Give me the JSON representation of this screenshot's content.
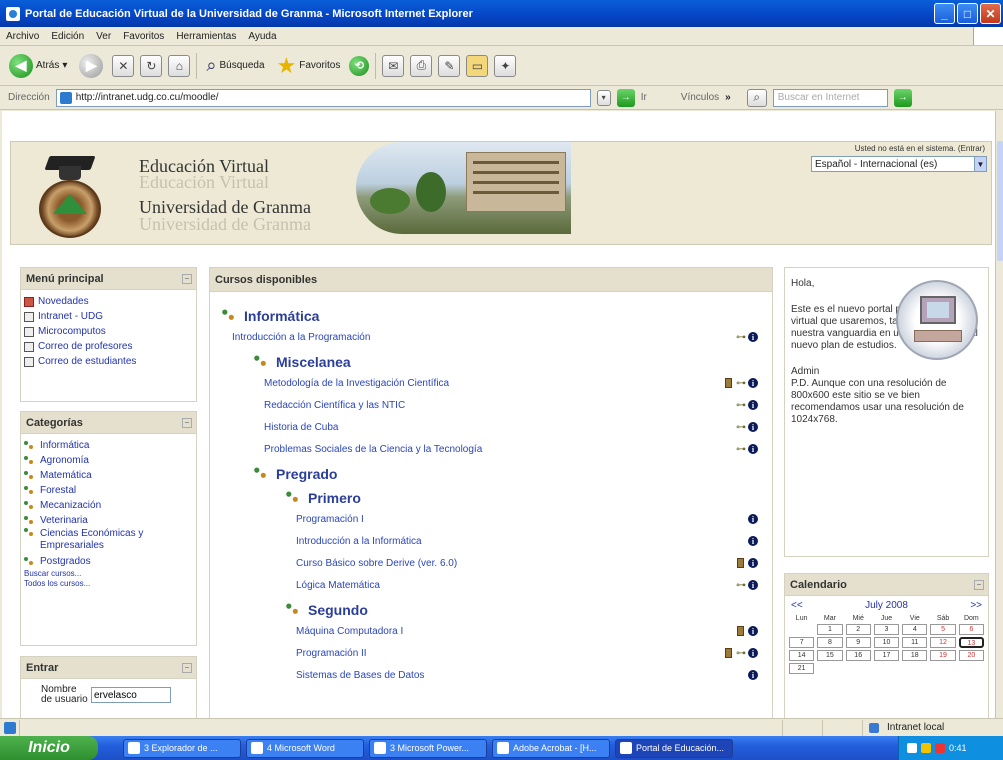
{
  "window": {
    "title": "Portal de Educación Virtual de la Universidad de Granma - Microsoft Internet Explorer",
    "min": "_",
    "max": "□",
    "close": "✕"
  },
  "menu": [
    "Archivo",
    "Edición",
    "Ver",
    "Favoritos",
    "Herramientas",
    "Ayuda"
  ],
  "toolbar": {
    "back_label": "Atrás",
    "search_label": "Búsqueda",
    "favorites_label": "Favoritos"
  },
  "addressbar": {
    "label": "Dirección",
    "url": "http://intranet.udg.co.cu/moodle/",
    "go_label": "Ir",
    "links_label": "Vínculos",
    "search_placeholder": "Buscar en Internet"
  },
  "header": {
    "title_line1": "Educación Virtual",
    "title_line2": "Universidad de Granma",
    "login_info": "Usted no está en el sistema. (Entrar)",
    "language": "Español - Internacional (es)"
  },
  "main_menu": {
    "title": "Menú principal",
    "items": [
      {
        "label": "Novedades",
        "icon": "news-icon"
      },
      {
        "label": "Intranet - UDG",
        "icon": "page-icon"
      },
      {
        "label": "Microcomputos",
        "icon": "page-icon"
      },
      {
        "label": "Correo de profesores",
        "icon": "page-icon"
      },
      {
        "label": "Correo de estudiantes",
        "icon": "page-icon"
      }
    ]
  },
  "categories": {
    "title": "Categorías",
    "items": [
      "Informática",
      "Agronomía",
      "Matemática",
      "Forestal",
      "Mecanización",
      "Veterinaria",
      "Ciencias Económicas y Empresariales",
      "Postgrados"
    ],
    "search_link": "Buscar cursos...",
    "all_link": "Todos los cursos..."
  },
  "login": {
    "title": "Entrar",
    "username_label": "Nombre de usuario",
    "username_value": "ervelasco"
  },
  "courses": {
    "title": "Cursos disponibles",
    "sections": [
      {
        "kind": "cat",
        "level": 0,
        "label": "Informática"
      },
      {
        "kind": "course",
        "level": 0,
        "label": "Introducción a la Programación",
        "icons": [
          "key",
          "info"
        ]
      },
      {
        "kind": "cat",
        "level": 1,
        "label": "Miscelanea"
      },
      {
        "kind": "course",
        "level": 1,
        "label": "Metodología de la Investigación Científica",
        "icons": [
          "teacher",
          "key",
          "info"
        ]
      },
      {
        "kind": "course",
        "level": 1,
        "label": "Redacción Científica y las NTIC",
        "icons": [
          "key",
          "info"
        ]
      },
      {
        "kind": "course",
        "level": 1,
        "label": "Historia de Cuba",
        "icons": [
          "key",
          "info"
        ]
      },
      {
        "kind": "course",
        "level": 1,
        "label": "Problemas Sociales de la Ciencia y la Tecnología",
        "icons": [
          "key",
          "info"
        ]
      },
      {
        "kind": "cat",
        "level": 1,
        "label": "Pregrado"
      },
      {
        "kind": "cat",
        "level": 2,
        "label": "Primero"
      },
      {
        "kind": "course",
        "level": 2,
        "label": "Programación I",
        "icons": [
          "info"
        ]
      },
      {
        "kind": "course",
        "level": 2,
        "label": "Introducción a la Informática",
        "icons": [
          "info"
        ]
      },
      {
        "kind": "course",
        "level": 2,
        "label": "Curso Básico sobre Derive (ver. 6.0)",
        "icons": [
          "teacher",
          "info"
        ]
      },
      {
        "kind": "course",
        "level": 2,
        "label": "Lógica Matemática",
        "icons": [
          "key",
          "info"
        ]
      },
      {
        "kind": "cat",
        "level": 2,
        "label": "Segundo"
      },
      {
        "kind": "course",
        "level": 2,
        "label": "Máquina Computadora I",
        "icons": [
          "teacher",
          "info"
        ]
      },
      {
        "kind": "course",
        "level": 2,
        "label": "Programación II",
        "icons": [
          "teacher",
          "key",
          "info"
        ]
      },
      {
        "kind": "course",
        "level": 2,
        "label": "Sistemas de Bases de Datos",
        "icons": [
          "info"
        ]
      }
    ]
  },
  "welcome": {
    "greeting": "Hola,",
    "body1": "Este es el nuevo portal para la educación virtual que usaremos, también será nuestra vanguardia en un acercamiento al nuevo plan de estudios.",
    "signature": "Admin",
    "body2": "P.D. Aunque con una resolución de 800x600 este sitio se ve bien recomendamos usar una resolución de 1024x768."
  },
  "calendar": {
    "title": "Calendario",
    "prev": "<<",
    "next": ">>",
    "month": "July 2008",
    "days": [
      "Lun",
      "Mar",
      "Mié",
      "Jue",
      "Vie",
      "Sáb",
      "Dom"
    ],
    "today": 13
  },
  "status": {
    "zone": "Intranet local"
  },
  "taskbar": {
    "start": "Inicio",
    "tasks": [
      {
        "label": "3 Explorador de ...",
        "active": false
      },
      {
        "label": "4 Microsoft Word",
        "active": false
      },
      {
        "label": "3 Microsoft Power...",
        "active": false
      },
      {
        "label": "Adobe Acrobat - [H...",
        "active": false
      },
      {
        "label": "Portal de Educación...",
        "active": true
      }
    ],
    "clock": "0:41"
  }
}
